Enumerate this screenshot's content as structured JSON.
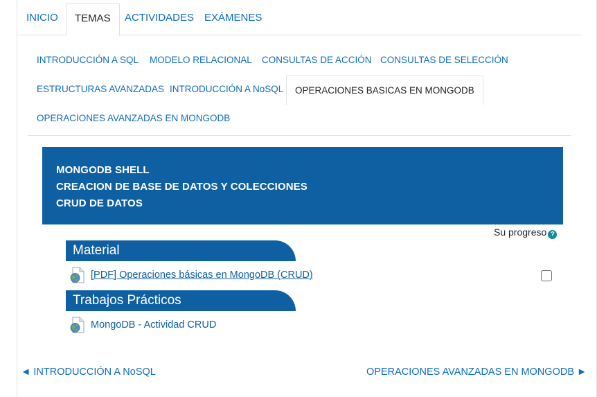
{
  "top_tabs": [
    {
      "label": "INICIO"
    },
    {
      "label": "TEMAS"
    },
    {
      "label": "ACTIVIDADES"
    },
    {
      "label": "EXÁMENES"
    }
  ],
  "sub_tabs": [
    {
      "label": "INTRODUCCIÓN A SQL"
    },
    {
      "label": "MODELO RELACIONAL"
    },
    {
      "label": "CONSULTAS DE ACCIÓN"
    },
    {
      "label": "CONSULTAS DE SELECCIÓN"
    },
    {
      "label": "ESTRUCTURAS AVANZADAS"
    },
    {
      "label": "INTRODUCCIÓN A NoSQL"
    },
    {
      "label": "OPERACIONES BASICAS EN MONGODB"
    },
    {
      "label": "OPERACIONES AVANZADAS EN MONGODB"
    }
  ],
  "summary": {
    "lines": [
      "MONGODB SHELL",
      "CREACION DE BASE DE DATOS Y COLECCIONES",
      "CRUD DE DATOS"
    ]
  },
  "progress": {
    "label": "Su progreso",
    "help_icon": "?"
  },
  "sections": [
    {
      "title": "Material",
      "activity": "[PDF] Operaciones básicas en MongoDB (CRUD)"
    },
    {
      "title": "Trabajos Prácticos",
      "activity": "MongoDB - Actividad CRUD"
    }
  ],
  "nav": {
    "prev": "◄ INTRODUCCIÓN A NoSQL",
    "next": "OPERACIONES AVANZADAS EN MONGODB ►"
  },
  "colors": {
    "primary": "#0f6cbf",
    "banner": "#0f5fa3",
    "help": "#0f8a9c"
  }
}
